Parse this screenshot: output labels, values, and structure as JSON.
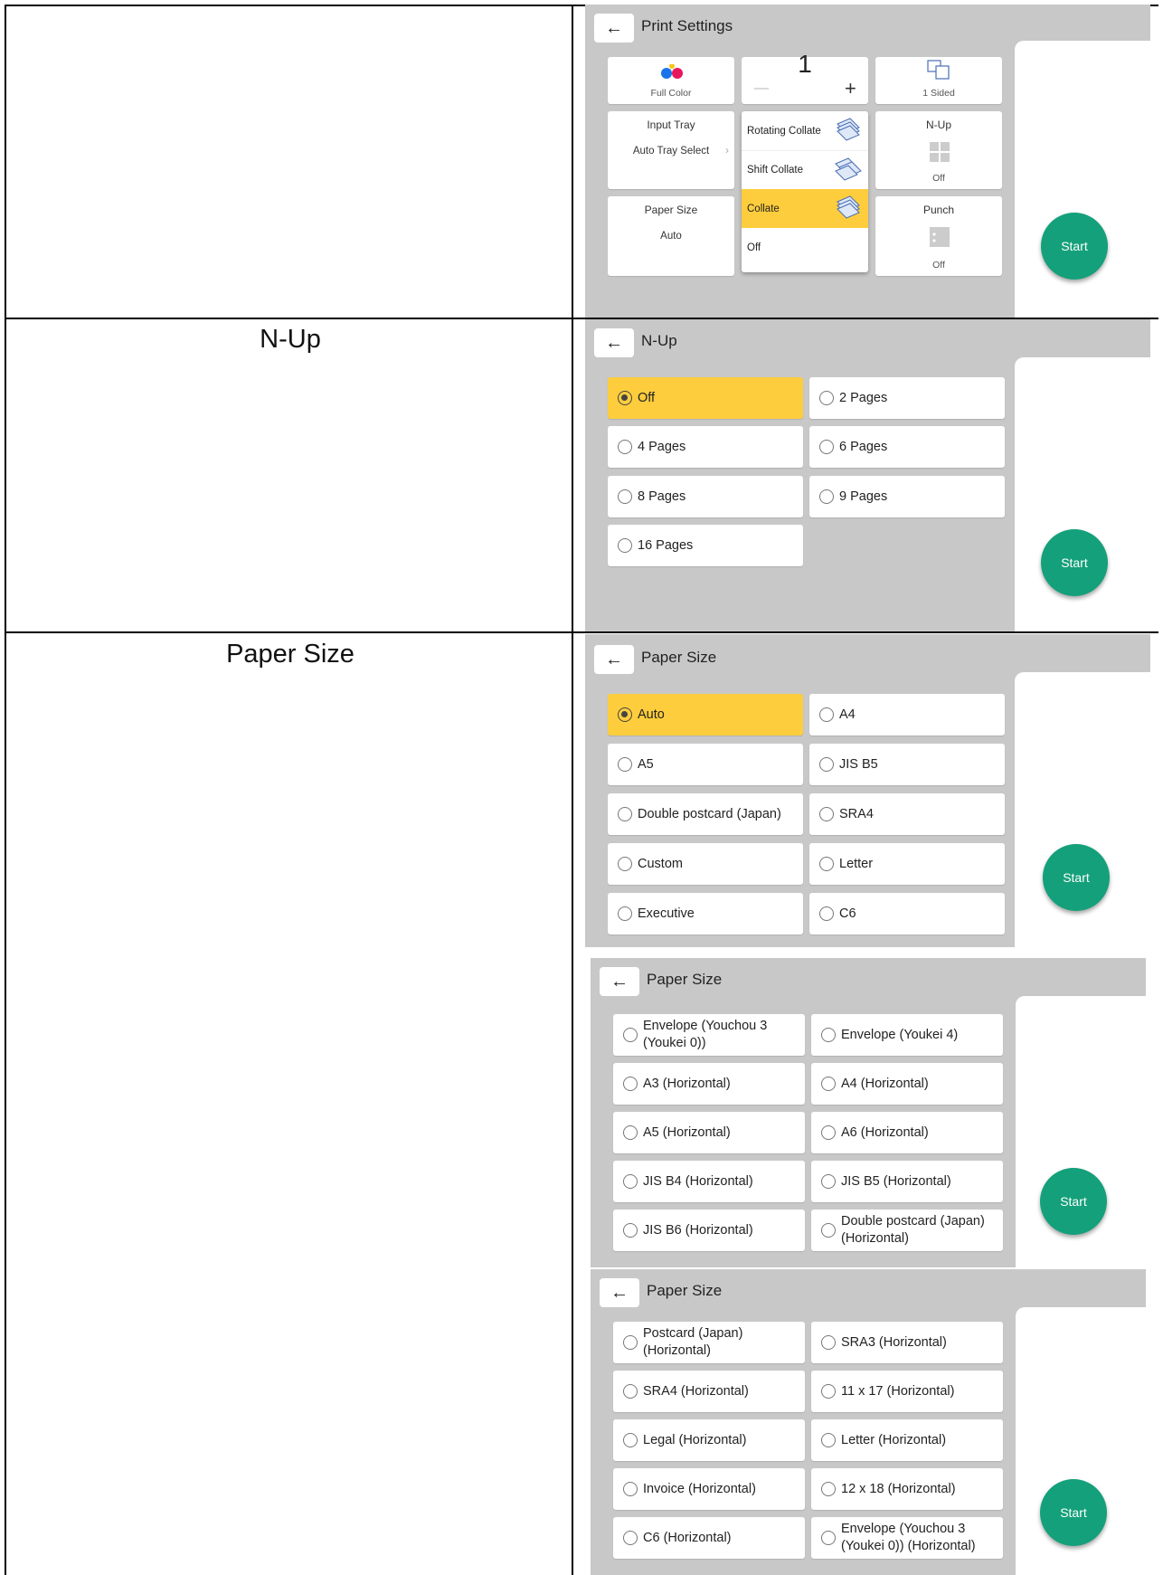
{
  "rows": {
    "nup_label": "N-Up",
    "paper_label": "Paper Size"
  },
  "print_settings": {
    "title": "Print Settings",
    "full_color": "Full Color",
    "copies": "1",
    "minus": "—",
    "plus": "+",
    "sided": "1 Sided",
    "input_tray_title": "Input Tray",
    "input_tray_value": "Auto Tray Select",
    "paper_size_title": "Paper Size",
    "paper_size_value": "Auto",
    "nup_title": "N-Up",
    "nup_value": "Off",
    "punch_title": "Punch",
    "punch_value": "Off",
    "collate_options": [
      "Rotating Collate",
      "Shift Collate",
      "Collate",
      "Off"
    ],
    "collate_selected": "Collate"
  },
  "nup_panel": {
    "title": "N-Up",
    "options": [
      "Off",
      "2 Pages",
      "4 Pages",
      "6 Pages",
      "8 Pages",
      "9 Pages",
      "16 Pages"
    ],
    "selected": "Off"
  },
  "paper_panel_1": {
    "title": "Paper Size",
    "options": [
      "Auto",
      "A4",
      "A5",
      "JIS B5",
      "Double postcard (Japan)",
      "SRA4",
      "Custom",
      "Letter",
      "Executive",
      "C6"
    ],
    "selected": "Auto"
  },
  "paper_panel_2": {
    "title": "Paper Size",
    "options": [
      "Envelope (Youchou 3 (Youkei 0))",
      "Envelope (Youkei 4)",
      "A3 (Horizontal)",
      "A4 (Horizontal)",
      "A5 (Horizontal)",
      "A6 (Horizontal)",
      "JIS B4 (Horizontal)",
      "JIS B5 (Horizontal)",
      "JIS B6 (Horizontal)",
      "Double postcard (Japan) (Horizontal)"
    ]
  },
  "paper_panel_3": {
    "title": "Paper Size",
    "options": [
      "Postcard (Japan) (Horizontal)",
      "SRA3 (Horizontal)",
      "SRA4 (Horizontal)",
      "11 x 17 (Horizontal)",
      "Legal (Horizontal)",
      "Letter (Horizontal)",
      "Invoice (Horizontal)",
      "12 x 18 (Horizontal)",
      "C6 (Horizontal)",
      "Envelope (Youchou 3 (Youkei 0)) (Horizontal)"
    ]
  },
  "start_label": "Start",
  "colors": {
    "selected": "#fdcd3d",
    "start": "#14a07a",
    "panel": "#c8c8c8"
  }
}
